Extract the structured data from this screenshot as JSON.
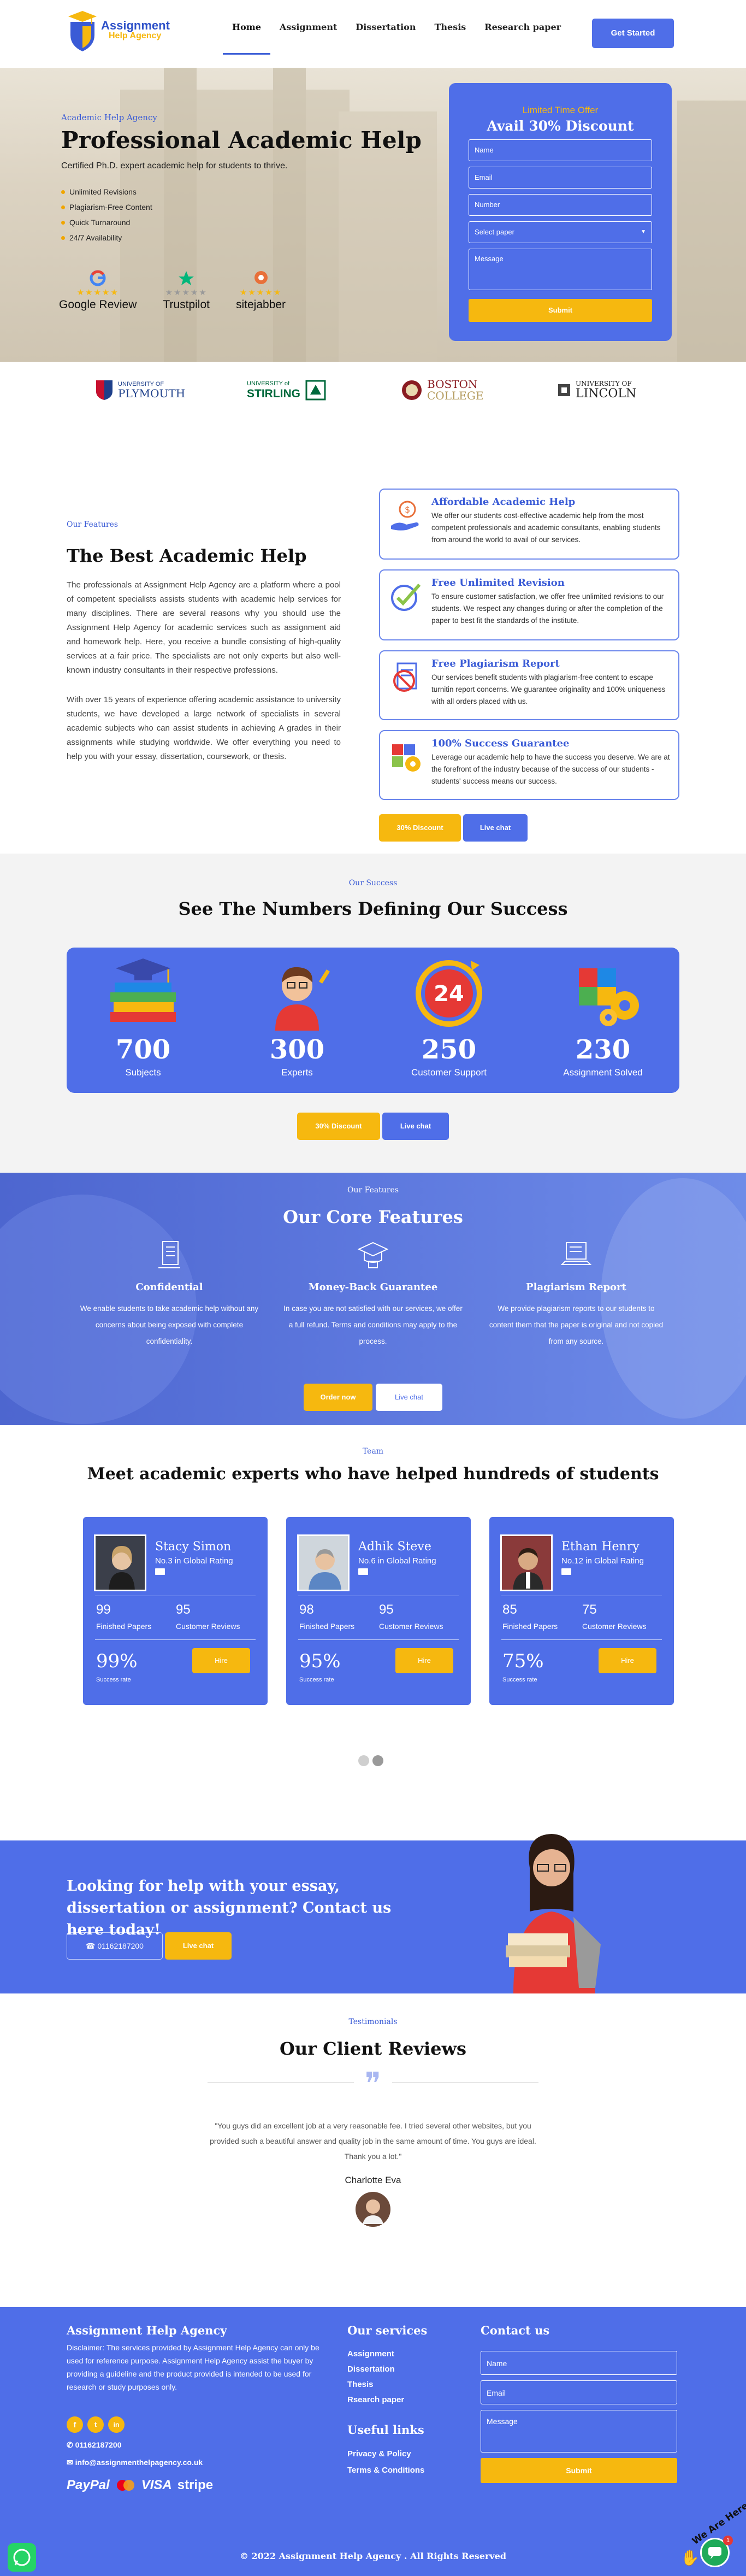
{
  "header": {
    "logo": {
      "line1": "Assignment",
      "line2": "Help Agency"
    },
    "nav": [
      "Home",
      "Assignment",
      "Dissertation",
      "Thesis",
      "Research paper"
    ],
    "cta": "Get Started"
  },
  "hero": {
    "eyebrow": "Academic Help Agency",
    "title": "Professional Academic Help",
    "subtitle": "Certified Ph.D. expert academic help for students to thrive.",
    "bullets": [
      "Unlimited Revisions",
      "Plagiarism-Free Content",
      "Quick Turnaround",
      "24/7 Availability"
    ],
    "reviews": [
      "Google Review",
      "Trustpilot",
      "sitejabber"
    ],
    "form": {
      "offer": "Limited Time Offer",
      "title": "Avail 30% Discount",
      "name": "Name",
      "email": "Email",
      "number": "Number",
      "select": "Select paper",
      "message": "Message",
      "submit": "Submit"
    }
  },
  "universities": [
    {
      "name": "UNIVERSITY OF",
      "name2": "PLYMOUTH"
    },
    {
      "name": "UNIVERSITY of",
      "name2": "STIRLING"
    },
    {
      "name": "BOSTON",
      "name2": "COLLEGE"
    },
    {
      "name": "UNIVERSITY OF",
      "name2": "LINCOLN"
    }
  ],
  "features": {
    "eyebrow": "Our Features",
    "title": "The Best Academic Help",
    "para1": "The professionals at Assignment Help Agency are a platform where a pool of competent specialists assists students with academic help services for many disciplines. There are several reasons why you should use the Assignment Help Agency for academic services such as assignment aid and homework help. Here, you receive a bundle consisting of high-quality services at a fair price. The specialists are not only experts but also well-known industry consultants in their respective professions.",
    "para2": "With over 15 years of experience offering academic assistance to university students, we have developed a large network of specialists in several academic subjects who can assist students in achieving A grades in their assignments while studying worldwide. We offer everything you need to help you with your essay, dissertation, coursework, or thesis.",
    "cards": [
      {
        "title": "Affordable Academic Help",
        "text": "We offer our students cost-effective academic help from the most competent professionals and academic consultants, enabling students from around the world to avail of our services."
      },
      {
        "title": "Free Unlimited Revision",
        "text": "To ensure customer satisfaction, we offer free unlimited revisions to our students. We respect any changes during or after the completion of the paper to best fit the standards of the institute."
      },
      {
        "title": "Free Plagiarism Report",
        "text": "Our services benefit students with plagiarism-free content to escape turnitin report concerns. We guarantee originality and 100% uniqueness with all orders placed with us."
      },
      {
        "title": "100% Success Guarantee",
        "text": "Leverage our academic help to have the success you deserve. We are at the forefront of the industry because of the success of our students - students' success means our success."
      }
    ],
    "discount_btn": "30% Discount",
    "chat_btn": "Live chat"
  },
  "numbers": {
    "eyebrow": "Our Success",
    "title": "See The Numbers Defining Our Success",
    "stats": [
      {
        "value": "700",
        "label": "Subjects"
      },
      {
        "value": "300",
        "label": "Experts"
      },
      {
        "value": "250",
        "label": "Customer Support"
      },
      {
        "value": "230",
        "label": "Assignment Solved"
      }
    ],
    "clock_label": "24",
    "discount_btn": "30% Discount",
    "chat_btn": "Live chat"
  },
  "core": {
    "eyebrow": "Our Features",
    "title": "Our Core Features",
    "items": [
      {
        "title": "Confidential",
        "text": "We enable students to take academic help without any concerns about being exposed with complete confidentiality."
      },
      {
        "title": "Money-Back Guarantee",
        "text": "In case you are not satisfied with our services, we offer a full refund. Terms and conditions may apply to the process."
      },
      {
        "title": "Plagiarism Report",
        "text": "We provide plagiarism reports to our students to content them that the paper is original and not copied from any source."
      }
    ],
    "order_btn": "Order now",
    "chat_btn": "Live chat"
  },
  "team": {
    "eyebrow": "Team",
    "title": "Meet academic experts who have helped hundreds of students",
    "experts": [
      {
        "name": "Stacy Simon",
        "rank": "No.3 in Global Rating",
        "papers": "99",
        "papers_label": "Finished Papers",
        "reviews": "95",
        "reviews_label": "Customer Reviews",
        "success": "99%",
        "success_label": "Success rate",
        "hire": "Hire"
      },
      {
        "name": "Adhik Steve",
        "rank": "No.6 in Global Rating",
        "papers": "98",
        "papers_label": "Finished Papers",
        "reviews": "95",
        "reviews_label": "Customer Reviews",
        "success": "95%",
        "success_label": "Success rate",
        "hire": "Hire"
      },
      {
        "name": "Ethan Henry",
        "rank": "No.12 in Global Rating",
        "papers": "85",
        "papers_label": "Finished Papers",
        "reviews": "75",
        "reviews_label": "Customer Reviews",
        "success": "75%",
        "success_label": "Success rate",
        "hire": "Hire"
      }
    ]
  },
  "cta": {
    "title": "Looking for help with your essay, dissertation or assignment? Contact us here today!",
    "phone": "01162187200",
    "chat_btn": "Live chat"
  },
  "testimonials": {
    "eyebrow": "Testimonials",
    "title": "Our Client Reviews",
    "quote": "\"You guys did an excellent job at a very reasonable fee. I tried several other websites, but you provided such a beautiful answer and quality job in the same amount of time. You guys are ideal. Thank you a lot.\"",
    "name": "Charlotte Eva"
  },
  "footer": {
    "brand": "Assignment Help Agency",
    "disclaimer": "Disclaimer: The services provided by Assignment Help Agency can only be used for reference purpose. Assignment Help Agency assist the buyer by providing a guideline and the product provided is intended to be used for research or study purposes only.",
    "phone": "01162187200",
    "email": "info@assignmenthelpagency.co.uk",
    "payments": [
      "PayPal",
      "VISA",
      "stripe"
    ],
    "services_title": "Our services",
    "services": [
      "Assignment",
      "Dissertation",
      "Thesis",
      "Rsearch paper"
    ],
    "useful_title": "Useful links",
    "useful": [
      "Privacy & Policy",
      "Terms & Conditions"
    ],
    "contact_title": "Contact us",
    "contact": {
      "name": "Name",
      "email": "Email",
      "message": "Message",
      "submit": "Submit"
    },
    "copyright": "© 2022 Assignment Help Agency . All Rights Reserved",
    "chat_badge": "We Are Here!",
    "chat_count": "1"
  },
  "colors": {
    "primary": "#4f6ee8",
    "accent": "#f6b80f",
    "eyebrow": "#3a5bd6"
  }
}
